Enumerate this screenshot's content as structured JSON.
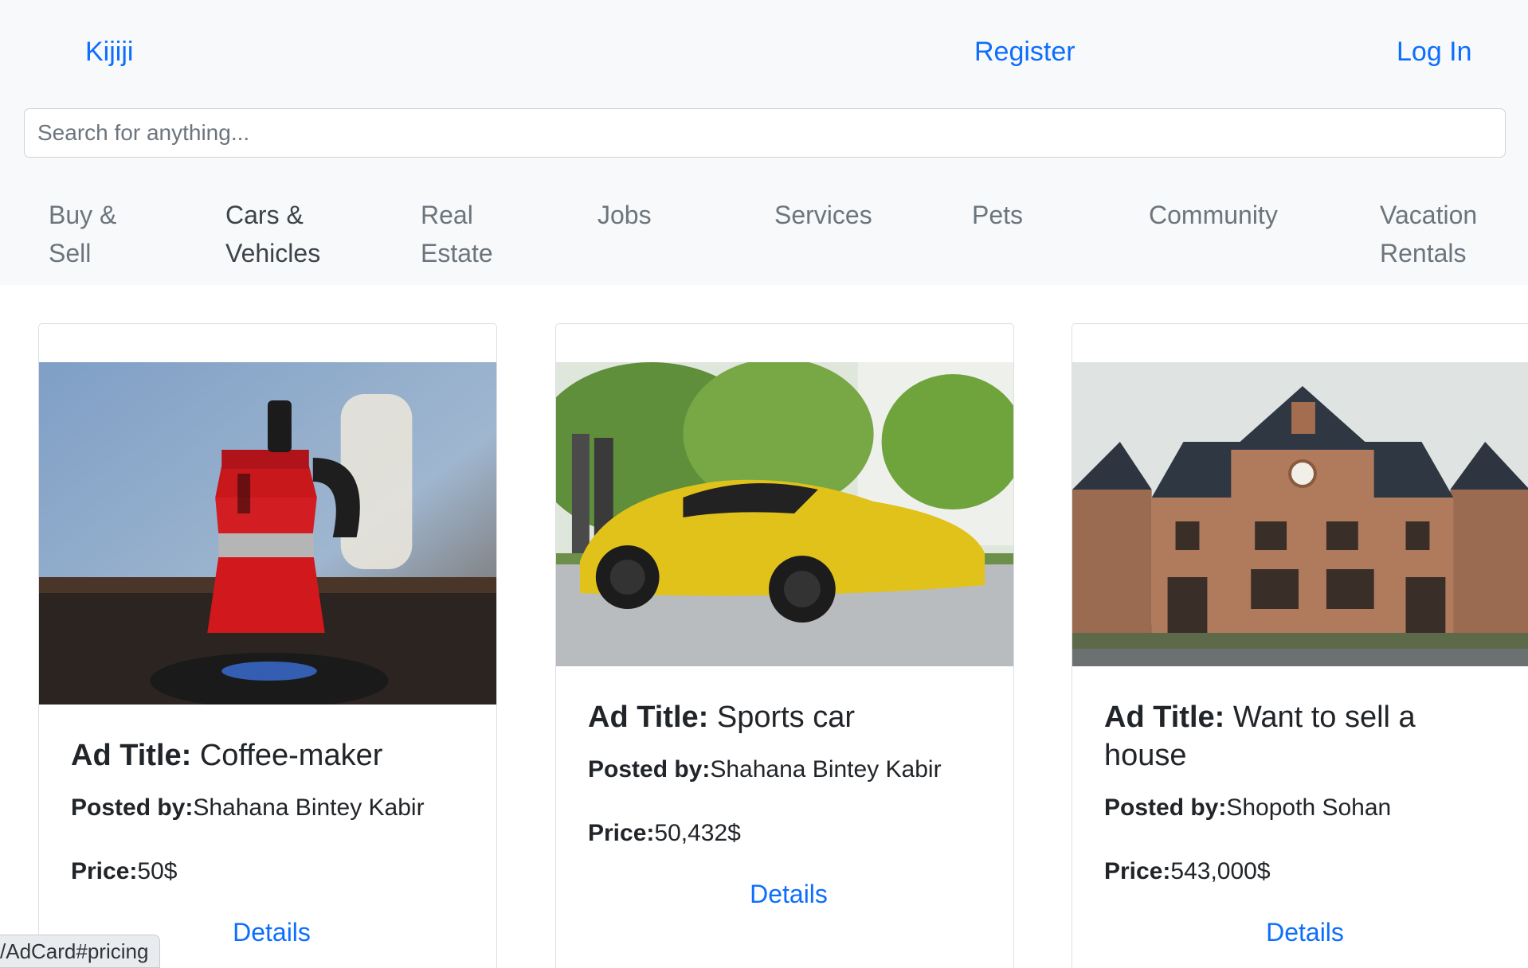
{
  "header": {
    "brand": "Kijiji",
    "register": "Register",
    "login": "Log In"
  },
  "search": {
    "placeholder": "Search for anything...",
    "value": ""
  },
  "categories": [
    {
      "line1": "Buy &",
      "line2": "Sell"
    },
    {
      "line1": "Cars &",
      "line2": "Vehicles"
    },
    {
      "line1": "Real",
      "line2": "Estate"
    },
    {
      "line1": "Jobs",
      "line2": ""
    },
    {
      "line1": "Services",
      "line2": ""
    },
    {
      "line1": "Pets",
      "line2": ""
    },
    {
      "line1": "Community",
      "line2": ""
    },
    {
      "line1": "Vacation",
      "line2": "Rentals"
    }
  ],
  "cards": [
    {
      "title_label": "Ad Title:",
      "title": "Coffee-maker",
      "posted_label": "Posted by:",
      "posted_by": "Shahana Bintey Kabir",
      "price_label": "Price:",
      "price": "50$",
      "details": "Details",
      "image": "coffee-maker-photo"
    },
    {
      "title_label": "Ad Title:",
      "title": "Sports car",
      "posted_label": "Posted by:",
      "posted_by": "Shahana Bintey Kabir",
      "price_label": "Price:",
      "price": "50,432$",
      "details": "Details",
      "image": "sports-car-photo"
    },
    {
      "title_label": "Ad Title:",
      "title": "Want to sell a house",
      "posted_label": "Posted by:",
      "posted_by": "Shopoth Sohan",
      "price_label": "Price:",
      "price": "543,000$",
      "details": "Details",
      "image": "house-photo"
    }
  ],
  "status_bar": {
    "url": "/AdCard#pricing"
  },
  "colors": {
    "link": "#0d6efd",
    "header_bg": "#f8f9fa",
    "muted": "#6c757d"
  }
}
